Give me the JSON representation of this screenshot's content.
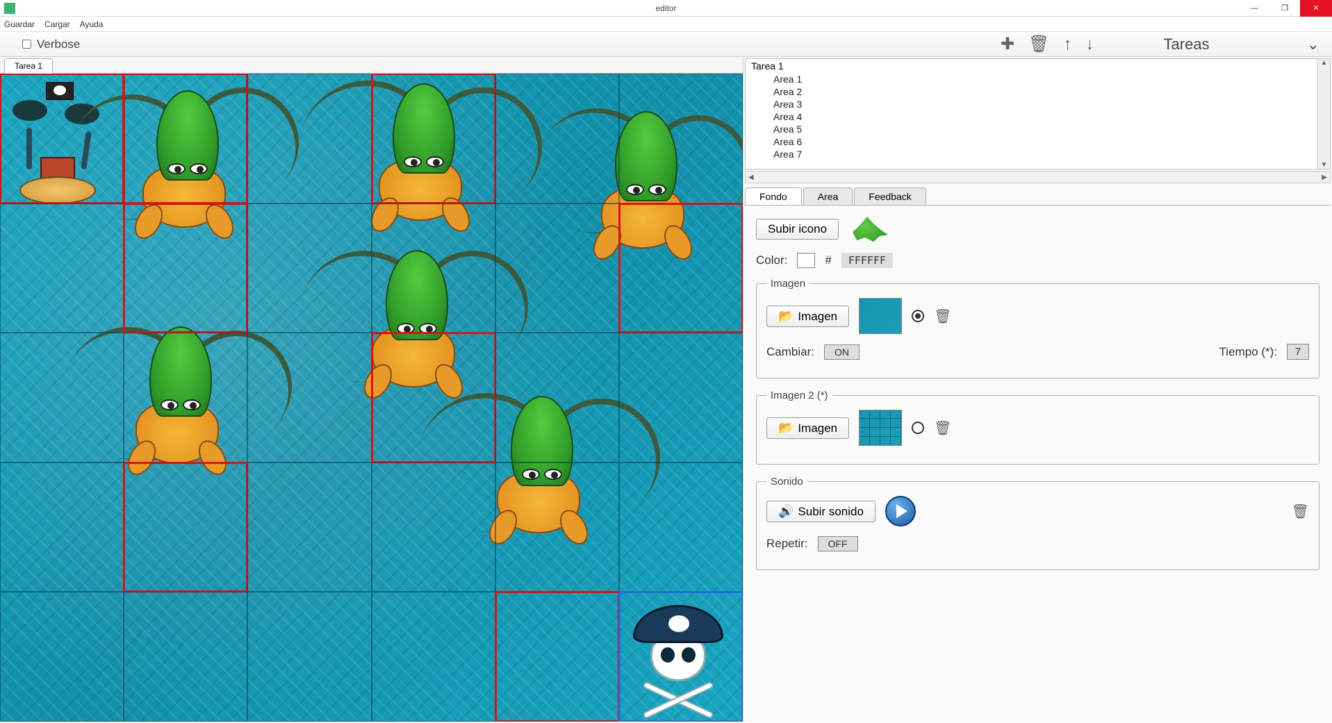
{
  "window": {
    "title": "editor"
  },
  "menu": {
    "guardar": "Guardar",
    "cargar": "Cargar",
    "ayuda": "Ayuda"
  },
  "toolbar": {
    "verbose": "Verbose",
    "tareas": "Tareas"
  },
  "tabs": {
    "main": "Tarea 1"
  },
  "tree": {
    "root": "Tarea 1",
    "items": [
      "Area 1",
      "Area 2",
      "Area 3",
      "Area 4",
      "Area 5",
      "Area 6",
      "Area 7"
    ]
  },
  "propTabs": {
    "fondo": "Fondo",
    "area": "Area",
    "feedback": "Feedback"
  },
  "props": {
    "subirIcono": "Subir icono",
    "colorLabel": "Color:",
    "hashLabel": "#",
    "hexValue": "FFFFFF",
    "imagenLegend": "Imagen",
    "imagenBtn": "Imagen",
    "cambiarLabel": "Cambiar:",
    "cambiarValue": "ON",
    "tiempoLabel": "Tiempo (*):",
    "tiempoValue": "7",
    "imagen2Legend": "Imagen 2 (*)",
    "sonidoLegend": "Sonido",
    "subirSonido": "Subir sonido",
    "repetirLabel": "Repetir:",
    "repetirValue": "OFF"
  }
}
